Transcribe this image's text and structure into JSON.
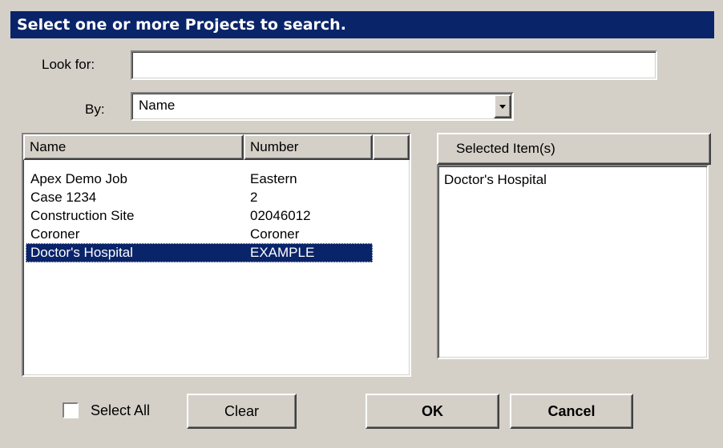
{
  "dialog": {
    "title": "Select one or more Projects to search."
  },
  "search": {
    "look_for_label": "Look for:",
    "look_for_value": "",
    "by_label": "By:",
    "by_value": "Name"
  },
  "list": {
    "columns": [
      "Name",
      "Number"
    ],
    "rows": [
      {
        "name": "Apex Demo Job",
        "number": "Eastern",
        "selected": false
      },
      {
        "name": "Case 1234",
        "number": "2",
        "selected": false
      },
      {
        "name": "Construction Site",
        "number": "02046012",
        "selected": false
      },
      {
        "name": "Coroner",
        "number": "Coroner",
        "selected": false
      },
      {
        "name": "Doctor's Hospital",
        "number": "EXAMPLE",
        "selected": true
      }
    ]
  },
  "selected_panel": {
    "header": "Selected Item(s)",
    "items": [
      "Doctor's Hospital"
    ]
  },
  "buttons": {
    "select_all": "Select All",
    "select_all_checked": false,
    "clear": "Clear",
    "ok": "OK",
    "cancel": "Cancel"
  },
  "colors": {
    "title_bg": "#0a246a",
    "selection_bg": "#0a246a",
    "face": "#d4d0c8"
  }
}
